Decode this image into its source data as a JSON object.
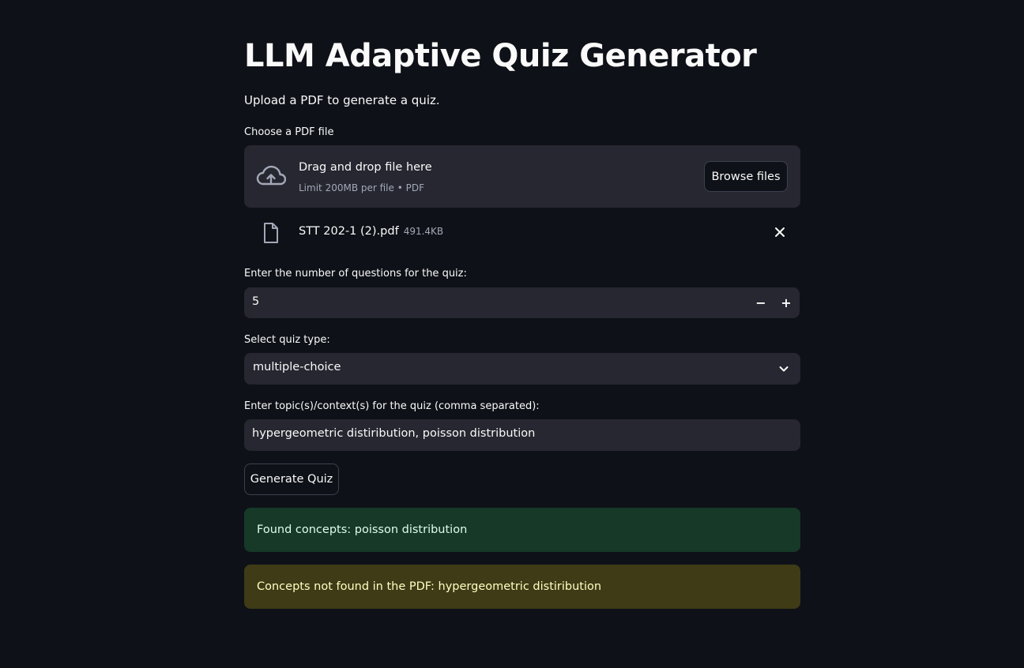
{
  "app": {
    "title": "LLM Adaptive Quiz Generator",
    "subtitle": "Upload a PDF to generate a quiz."
  },
  "uploader": {
    "label": "Choose a PDF file",
    "drop_text": "Drag and drop file here",
    "limit_text": "Limit 200MB per file • PDF",
    "browse_label": "Browse files",
    "file": {
      "name": "STT 202-1 (2).pdf",
      "size": "491.4KB"
    }
  },
  "num_questions": {
    "label": "Enter the number of questions for the quiz:",
    "value": "5",
    "decrement": "−",
    "increment": "+"
  },
  "quiz_type": {
    "label": "Select quiz type:",
    "selected": "multiple-choice"
  },
  "topics": {
    "label": "Enter topic(s)/context(s) for the quiz (comma separated):",
    "value": "hypergeometric distiribution, poisson distribution"
  },
  "generate_label": "Generate Quiz",
  "alerts": {
    "success": "Found concepts: poisson distribution",
    "warning": "Concepts not found in the PDF: hypergeometric distiribution"
  },
  "colors": {
    "background": "#0e1117",
    "widget": "#262730",
    "success_bg": "#173928",
    "warning_bg": "#3e3b16"
  }
}
